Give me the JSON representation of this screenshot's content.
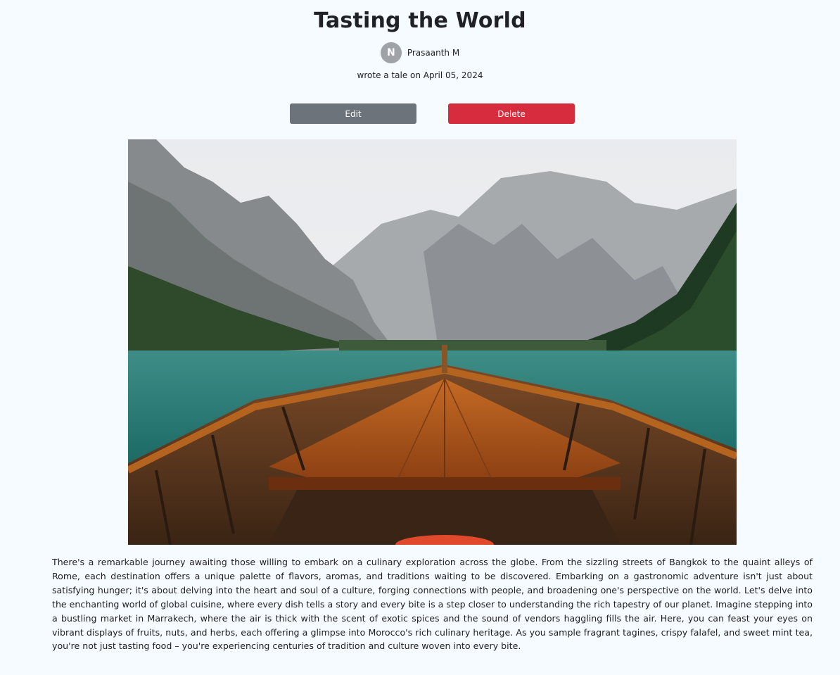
{
  "post": {
    "title": "Tasting the World",
    "author": {
      "initial": "N",
      "name": "Prasaanth M"
    },
    "meta": "wrote a tale on April 05, 2024",
    "actions": {
      "edit_label": "Edit",
      "delete_label": "Delete"
    },
    "image": {
      "alt": "Wooden boat bow on a mountain lake"
    },
    "body": "There's a remarkable journey awaiting those willing to embark on a culinary exploration across the globe. From the sizzling streets of Bangkok to the quaint alleys of Rome, each destination offers a unique palette of flavors, aromas, and traditions waiting to be discovered. Embarking on a gastronomic adventure isn't just about satisfying hunger; it's about delving into the heart and soul of a culture, forging connections with people, and broadening one's perspective on the world. Let's delve into the enchanting world of global cuisine, where every dish tells a story and every bite is a step closer to understanding the rich tapestry of our planet. Imagine stepping into a bustling market in Marrakech, where the air is thick with the scent of exotic spices and the sound of vendors haggling fills the air. Here, you can feast your eyes on vibrant displays of fruits, nuts, and herbs, each offering a glimpse into Morocco's rich culinary heritage. As you sample fragrant tagines, crispy falafel, and sweet mint tea, you're not just tasting food – you're experiencing centuries of tradition and culture woven into every bite."
  },
  "colors": {
    "background": "#f5fbff",
    "edit_button": "#6c737b",
    "delete_button": "#d72c3d",
    "avatar": "#9fa2a6"
  }
}
